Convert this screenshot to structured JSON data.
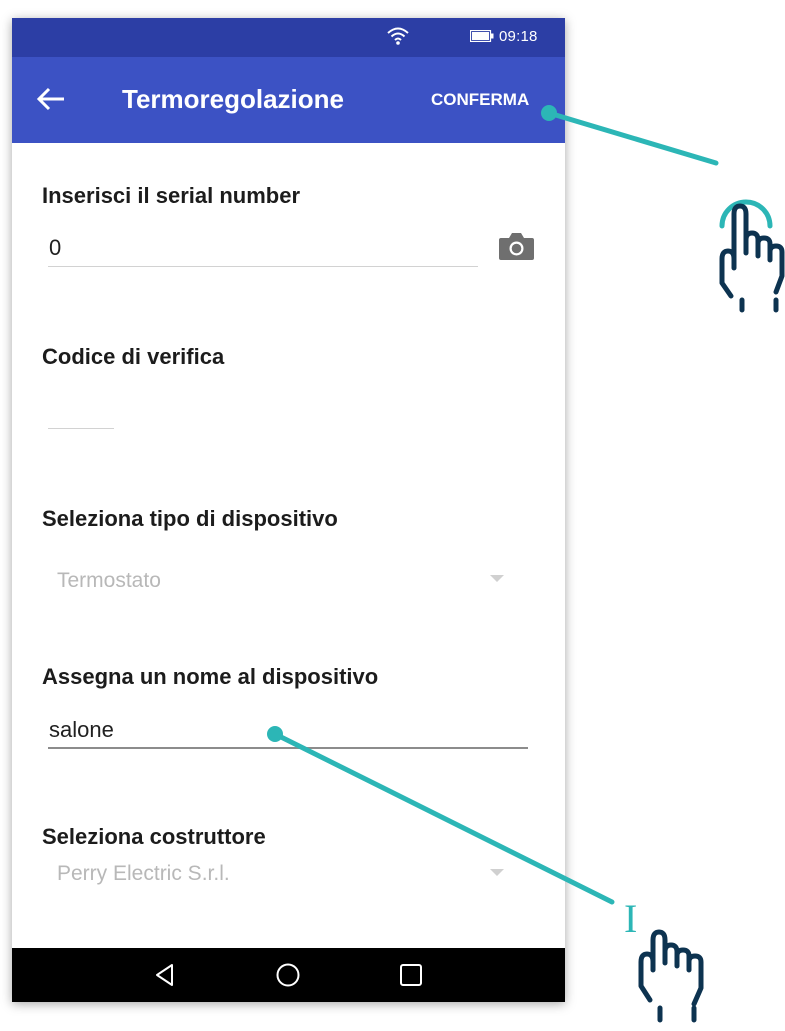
{
  "status_bar": {
    "time": "09:18"
  },
  "app_bar": {
    "title": "Termoregolazione",
    "confirm_label": "CONFERMA"
  },
  "form": {
    "serial": {
      "label": "Inserisci il serial number",
      "value": "0"
    },
    "verification": {
      "label": "Codice di verifica",
      "value": ""
    },
    "device_type": {
      "label": "Seleziona tipo di dispositivo",
      "selected": "Termostato"
    },
    "device_name": {
      "label": "Assegna un nome al dispositivo",
      "value": "salone"
    },
    "manufacturer": {
      "label": "Seleziona costruttore",
      "selected": "Perry Electric S.r.l."
    }
  },
  "annotations": {
    "text_cursor_glyph": "I"
  },
  "colors": {
    "status_bar": "#2c3ea5",
    "app_bar": "#3c52c4",
    "annotation": "#2cb6b6",
    "hand_stroke": "#0d3350"
  }
}
